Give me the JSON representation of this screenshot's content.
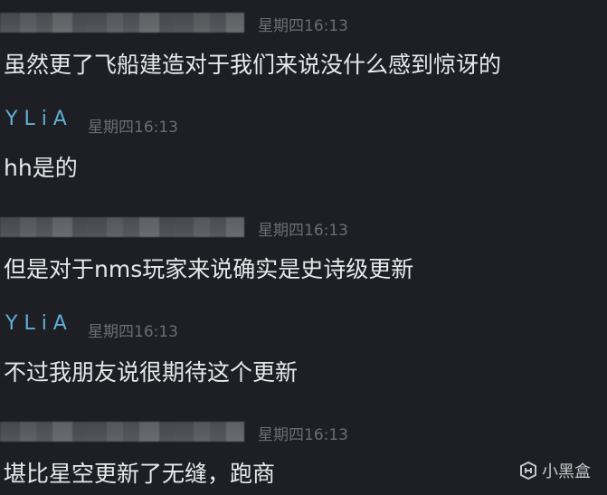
{
  "messages": [
    {
      "sender": "",
      "time": "星期四16:13",
      "text": "虽然更了飞船建造对于我们来说没什么感到惊讶的"
    },
    {
      "sender": "YLiA",
      "time": "星期四16:13",
      "text": "hh是的"
    },
    {
      "sender": "",
      "time": "星期四16:13",
      "text": "但是对于nms玩家来说确实是史诗级更新"
    },
    {
      "sender": "YLiA",
      "time": "星期四16:13",
      "text": "不过我朋友说很期待这个更新"
    },
    {
      "sender": "",
      "time": "星期四16:13",
      "text": "堪比星空更新了无缝，跑商"
    }
  ],
  "watermark": {
    "label": "小黑盒"
  },
  "colors": {
    "background": "#1e1f24",
    "name_accent": "#5fb0d6",
    "timestamp": "#6b6d73",
    "message_text": "#e8e8ea"
  }
}
